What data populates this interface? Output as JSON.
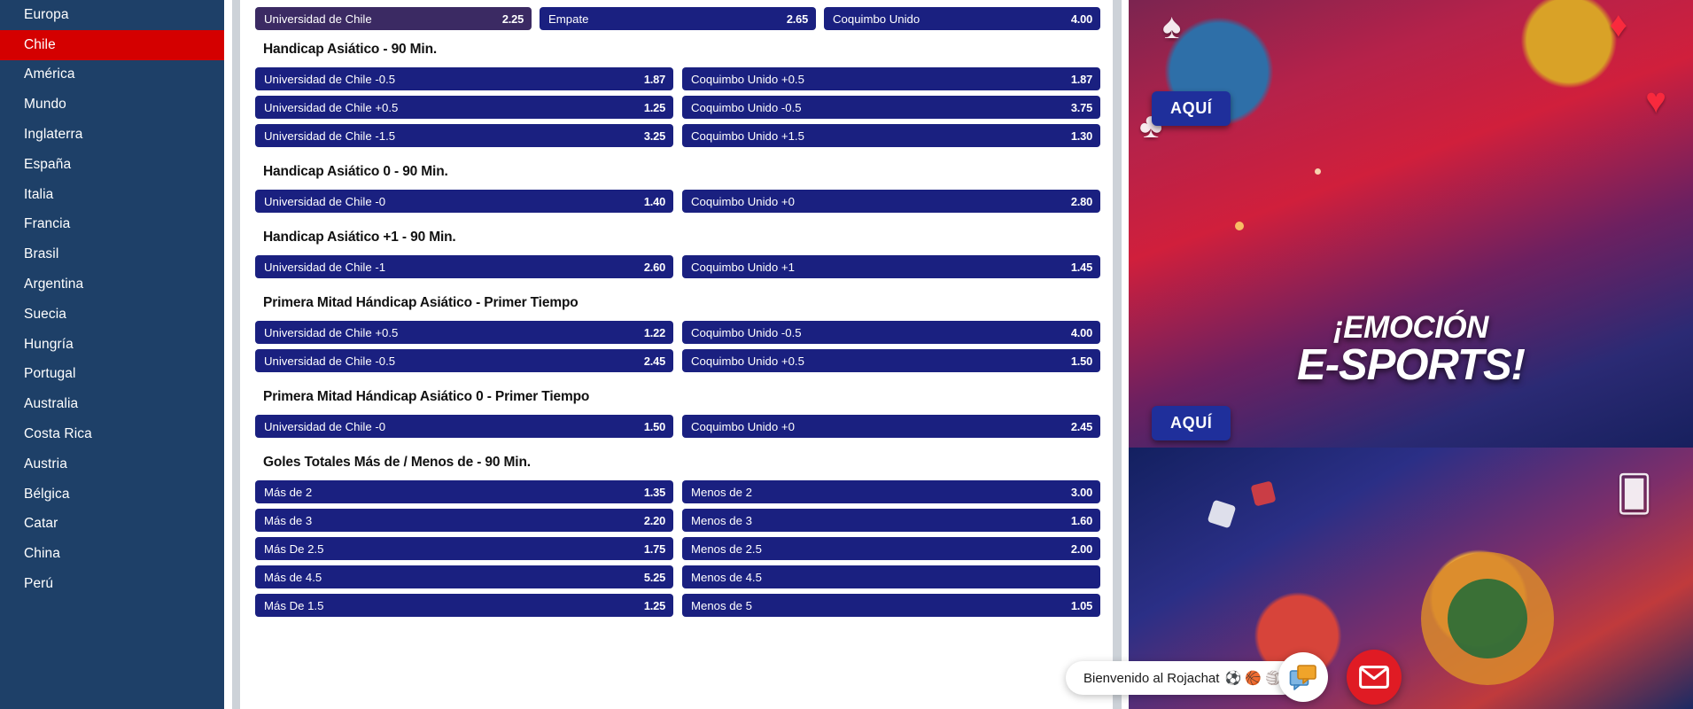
{
  "sidebar": {
    "items": [
      {
        "label": "Europa",
        "active": false
      },
      {
        "label": "Chile",
        "active": true
      },
      {
        "label": "América",
        "active": false
      },
      {
        "label": "Mundo",
        "active": false
      },
      {
        "label": "Inglaterra",
        "active": false
      },
      {
        "label": "España",
        "active": false
      },
      {
        "label": "Italia",
        "active": false
      },
      {
        "label": "Francia",
        "active": false
      },
      {
        "label": "Brasil",
        "active": false
      },
      {
        "label": "Argentina",
        "active": false
      },
      {
        "label": "Suecia",
        "active": false
      },
      {
        "label": "Hungría",
        "active": false
      },
      {
        "label": "Portugal",
        "active": false
      },
      {
        "label": "Australia",
        "active": false
      },
      {
        "label": "Costa Rica",
        "active": false
      },
      {
        "label": "Austria",
        "active": false
      },
      {
        "label": "Bélgica",
        "active": false
      },
      {
        "label": "Catar",
        "active": false
      },
      {
        "label": "China",
        "active": false
      },
      {
        "label": "Perú",
        "active": false
      }
    ]
  },
  "match": {
    "home_team": "Universidad de Chile",
    "away_team": "Coquimbo Unido",
    "draw_label": "Empate"
  },
  "moneyline": {
    "home": {
      "label": "Universidad de Chile",
      "odd": "2.25",
      "selected": true
    },
    "draw": {
      "label": "Empate",
      "odd": "2.65",
      "selected": false
    },
    "away": {
      "label": "Coquimbo Unido",
      "odd": "4.00",
      "selected": false
    }
  },
  "markets": [
    {
      "title": "Handicap Asiático - 90 Min.",
      "rows": [
        {
          "left": {
            "label": "Universidad de Chile -0.5",
            "odd": "1.87"
          },
          "right": {
            "label": "Coquimbo Unido +0.5",
            "odd": "1.87"
          }
        },
        {
          "left": {
            "label": "Universidad de Chile +0.5",
            "odd": "1.25"
          },
          "right": {
            "label": "Coquimbo Unido -0.5",
            "odd": "3.75"
          }
        },
        {
          "left": {
            "label": "Universidad de Chile -1.5",
            "odd": "3.25"
          },
          "right": {
            "label": "Coquimbo Unido +1.5",
            "odd": "1.30"
          }
        }
      ]
    },
    {
      "title": "Handicap Asiático 0 - 90 Min.",
      "rows": [
        {
          "left": {
            "label": "Universidad de Chile -0",
            "odd": "1.40"
          },
          "right": {
            "label": "Coquimbo Unido +0",
            "odd": "2.80"
          }
        }
      ]
    },
    {
      "title": "Handicap Asiático +1 - 90 Min.",
      "rows": [
        {
          "left": {
            "label": "Universidad de Chile -1",
            "odd": "2.60"
          },
          "right": {
            "label": "Coquimbo Unido +1",
            "odd": "1.45"
          }
        }
      ]
    },
    {
      "title": "Primera Mitad Hándicap Asiático - Primer Tiempo",
      "rows": [
        {
          "left": {
            "label": "Universidad de Chile +0.5",
            "odd": "1.22"
          },
          "right": {
            "label": "Coquimbo Unido -0.5",
            "odd": "4.00"
          }
        },
        {
          "left": {
            "label": "Universidad de Chile -0.5",
            "odd": "2.45"
          },
          "right": {
            "label": "Coquimbo Unido +0.5",
            "odd": "1.50"
          }
        }
      ]
    },
    {
      "title": "Primera Mitad Hándicap Asiático 0 - Primer Tiempo",
      "rows": [
        {
          "left": {
            "label": "Universidad de Chile -0",
            "odd": "1.50"
          },
          "right": {
            "label": "Coquimbo Unido +0",
            "odd": "2.45"
          }
        }
      ]
    },
    {
      "title": "Goles Totales Más de / Menos de - 90 Min.",
      "rows": [
        {
          "left": {
            "label": "Más de 2",
            "odd": "1.35"
          },
          "right": {
            "label": "Menos de 2",
            "odd": "3.00"
          }
        },
        {
          "left": {
            "label": "Más de 3",
            "odd": "2.20"
          },
          "right": {
            "label": "Menos de 3",
            "odd": "1.60"
          }
        },
        {
          "left": {
            "label": "Más De 2.5",
            "odd": "1.75"
          },
          "right": {
            "label": "Menos de 2.5",
            "odd": "2.00"
          }
        },
        {
          "left": {
            "label": "Más de 4.5",
            "odd": "5.25"
          },
          "right": {
            "label": "Menos de 4.5",
            "odd": ""
          }
        },
        {
          "left": {
            "label": "Más De 1.5",
            "odd": "1.25"
          },
          "right": {
            "label": "Menos de 5",
            "odd": "1.05"
          }
        }
      ]
    }
  ],
  "promos": [
    {
      "cta": "AQUÍ",
      "headline_1": "",
      "headline_2": ""
    },
    {
      "cta": "AQUÍ",
      "headline_1": "¡EMOCIÓN",
      "headline_2": "E-SPORTS!"
    }
  ],
  "chat": {
    "message": "Bienvenido al Rojachat",
    "emojis": "⚽ 🏀 🏐",
    "chat_icon": "chat-icon",
    "mail_icon": "mail-icon"
  },
  "colors": {
    "sidebar_bg": "#1e4068",
    "sidebar_active": "#d40000",
    "bet_bg": "#1a2080",
    "bet_selected": "#3b2a63",
    "mail_btn": "#e01b24"
  }
}
